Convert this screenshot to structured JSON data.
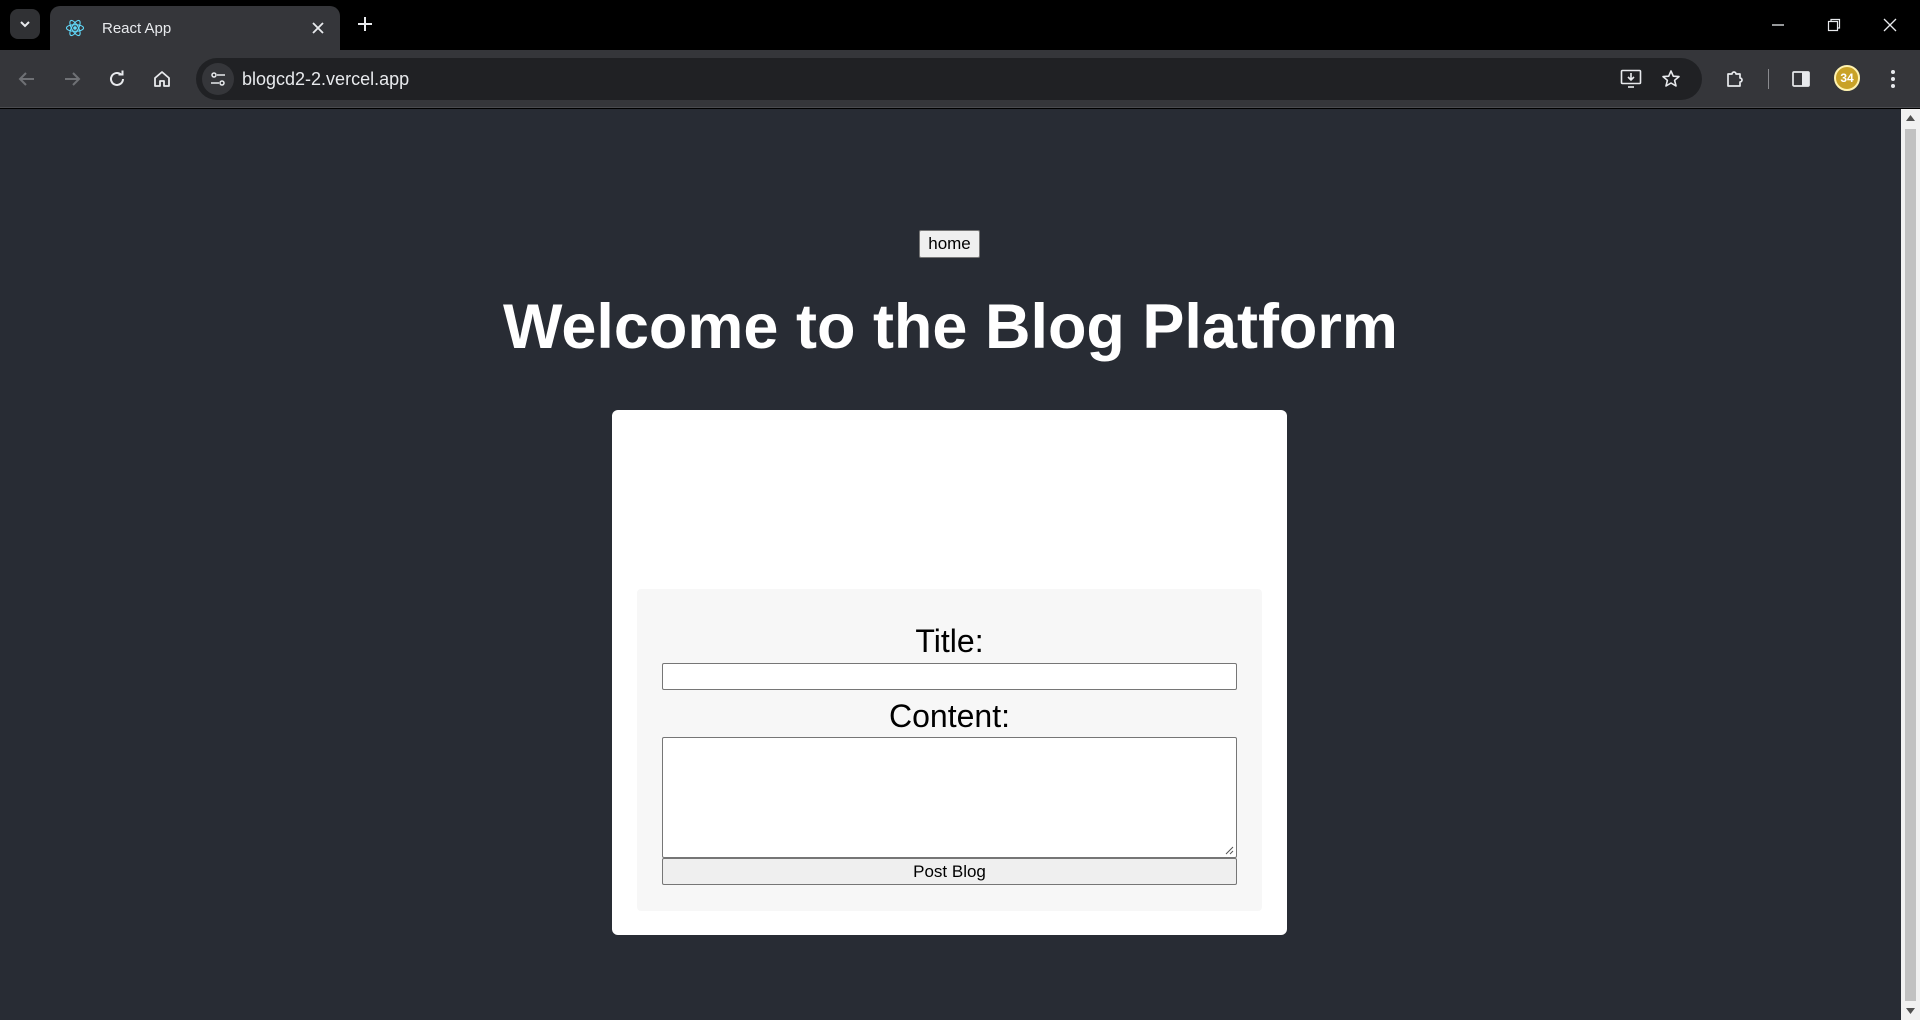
{
  "browser": {
    "tab": {
      "title": "React App",
      "favicon": "react-icon"
    },
    "address_bar": {
      "url": "blogcd2-2.vercel.app"
    },
    "profile": {
      "avatar_text": "34"
    },
    "colors": {
      "chrome_dark": "#000000",
      "toolbar": "#35363a",
      "omnibox": "#202124",
      "avatar": "#c9a227"
    }
  },
  "page": {
    "nav": {
      "home_label": "home"
    },
    "title": "Welcome to the Blog Platform",
    "form": {
      "title_label": "Title:",
      "title_value": "",
      "content_label": "Content:",
      "content_value": "",
      "submit_label": "Post Blog"
    },
    "colors": {
      "background": "#282c34",
      "card": "#ffffff",
      "form": "#f7f7f7",
      "text": "#ffffff"
    }
  }
}
